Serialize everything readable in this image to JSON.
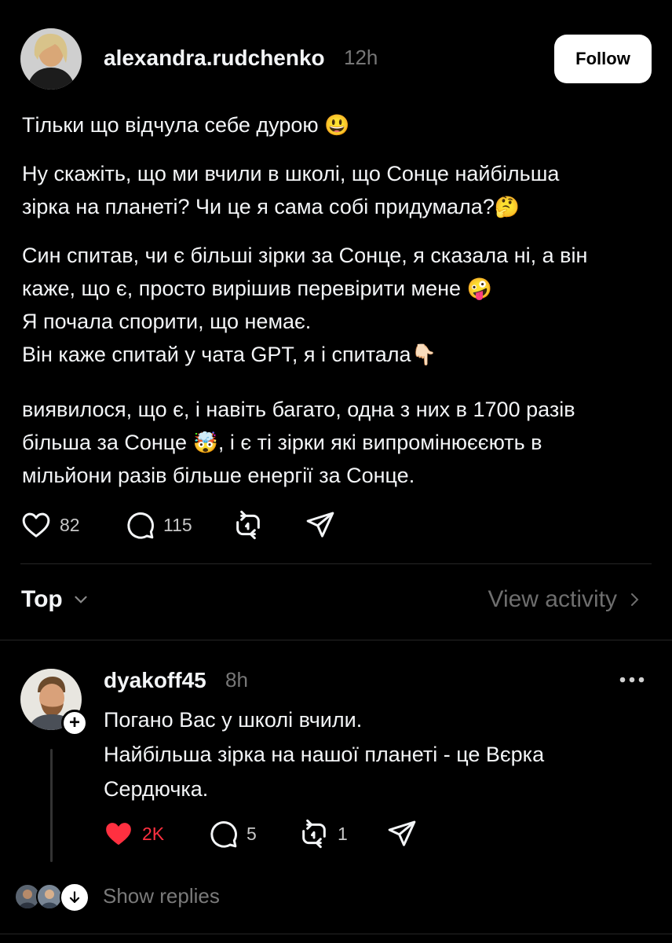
{
  "post": {
    "username": "alexandra.rudchenko",
    "time": "12h",
    "follow_label": "Follow",
    "lines": {
      "p1_l1": "Тільки що відчула себе дурою",
      "p1_emoji": "😃",
      "p2_l1": "Ну скажіть, що ми вчили в школі, що Сонце найбільша",
      "p2_l2": "зірка на планеті? Чи це я сама собі придумала?",
      "p2_emoji": "🤔",
      "p3_l1": "Син спитав, чи є більші зірки за Сонце, я сказала ні, а він",
      "p3_l2": "каже, що є, просто вирішив перевірити мене",
      "p3_emoji": "🤪",
      "p3_l3": "Я почала спорити, що немає.",
      "p3_l4": "Він каже спитай у чата GPT, я і спитала",
      "p3_emoji2": "👇🏻",
      "p4_l1": "виявилося, що є, і навіть багато,  одна з них в 1700 разів",
      "p4_l2a": "більша за Сонце",
      "p4_emoji": "🤯",
      "p4_l2b": ", і є ті зірки які випромінюєєють в",
      "p4_l3": "мільйони разів більше енергії за Сонце."
    },
    "likes": "82",
    "comments": "115"
  },
  "sort": {
    "label": "Top",
    "view_activity": "View activity"
  },
  "reply": {
    "username": "dyakoff45",
    "time": "8h",
    "line1": "Погано Вас у школі вчили.",
    "line2": "Найбільша зірка на нашої планеті - це Вєрка",
    "line3": "Сердючка.",
    "likes": "2K",
    "comments": "5",
    "reposts": "1",
    "show_replies": "Show replies"
  },
  "colors": {
    "background": "#000000",
    "text": "#f3f5f7",
    "muted": "#777777",
    "liked": "#ff3040"
  }
}
